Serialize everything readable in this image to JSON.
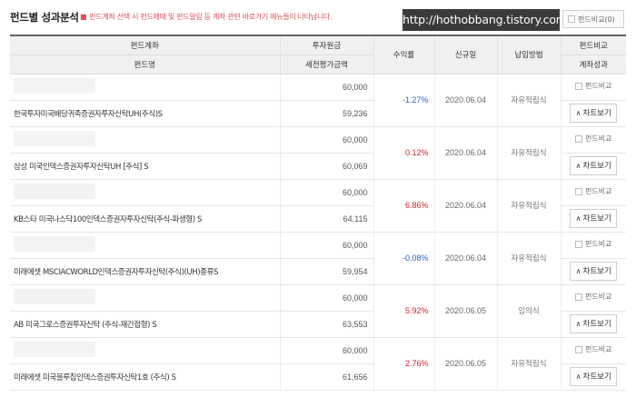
{
  "header": {
    "title": "펀드별 성과분석",
    "notice": "펀드계좌 선택 시 펀드매매 및 펀드알림 등 계좌 관련 바로가기 메뉴들이 나타납니다.",
    "watermark": "http://hothobbang.tistory.com",
    "compare_all_label": "펀드비교(0)"
  },
  "columns": {
    "account": "펀드계좌",
    "fund_name": "펀드명",
    "principal": "투자원금",
    "eval": "세전평가금액",
    "return_rate": "수익률",
    "new_date": "신규일",
    "payment": "납입방법",
    "compare": "펀드비교",
    "account_result": "계좌성과"
  },
  "row_controls": {
    "compare_label": "펀드비교",
    "chart_label": "차트보기"
  },
  "rows": [
    {
      "name": "한국투자미국배당귀족증권자투자신탁UH(주식)S",
      "principal": "60,000",
      "eval": "59,236",
      "rate": "-1.27%",
      "rate_sign": "neg",
      "date": "2020.06.04",
      "method": "자유적립식"
    },
    {
      "name": "삼성 미국인덱스증권자투자신탁UH [주식] S",
      "principal": "60,000",
      "eval": "60,069",
      "rate": "0.12%",
      "rate_sign": "pos",
      "date": "2020.06.04",
      "method": "자유적립식"
    },
    {
      "name": "KB스타 미국나스닥100인덱스증권자투자신탁(주식-파생형) S",
      "principal": "60,000",
      "eval": "64,115",
      "rate": "6.86%",
      "rate_sign": "pos",
      "date": "2020.06.04",
      "method": "자유적립식"
    },
    {
      "name": "미래에셋 MSCIACWORLD인덱스증권자투자신탁(주식)(UH)종류S",
      "principal": "60,000",
      "eval": "59,954",
      "rate": "-0.08%",
      "rate_sign": "neg",
      "date": "2020.06.04",
      "method": "자유적립식"
    },
    {
      "name": "AB 미국그로스증권투자신탁 (주식-재간접형) S",
      "principal": "60,000",
      "eval": "63,553",
      "rate": "5.92%",
      "rate_sign": "pos",
      "date": "2020.06.05",
      "method": "임의식"
    },
    {
      "name": "미래에셋 미국블루칩인덱스증권투자신탁1호 (주식) S",
      "principal": "60,000",
      "eval": "61,656",
      "rate": "2.76%",
      "rate_sign": "pos",
      "date": "2020.06.05",
      "method": "자유적립식"
    }
  ]
}
